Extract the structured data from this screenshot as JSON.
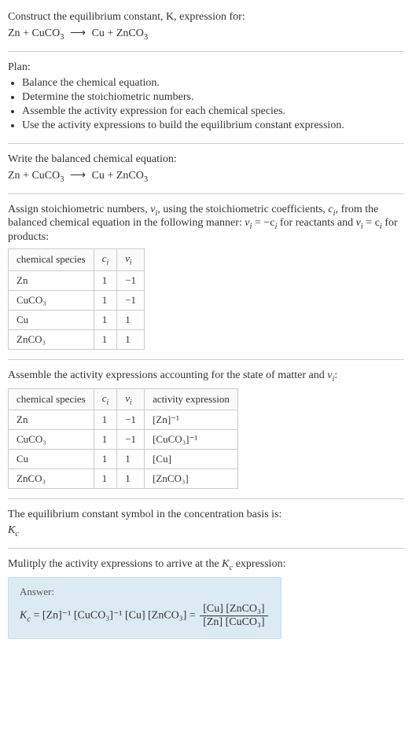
{
  "intro": {
    "line1": "Construct the equilibrium constant, K, expression for:",
    "equation_lhs_a": "Zn",
    "equation_lhs_b": "CuCO",
    "equation_lhs_b_sub": "3",
    "arrow": "⟶",
    "equation_rhs_a": "Cu",
    "equation_rhs_b": "ZnCO",
    "equation_rhs_b_sub": "3"
  },
  "plan": {
    "heading": "Plan:",
    "items": [
      "Balance the chemical equation.",
      "Determine the stoichiometric numbers.",
      "Assemble the activity expression for each chemical species.",
      "Use the activity expressions to build the equilibrium constant expression."
    ]
  },
  "balanced": {
    "heading": "Write the balanced chemical equation:"
  },
  "stoich": {
    "text_a": "Assign stoichiometric numbers, ",
    "nu": "ν",
    "sub_i": "i",
    "text_b": ", using the stoichiometric coefficients, ",
    "c": "c",
    "text_c": ", from the balanced chemical equation in the following manner: ",
    "eq1_lhs": "ν",
    "eq1_rhs": " = −c",
    "text_d": " for reactants and ",
    "eq2_rhs": " = c",
    "text_e": " for products:",
    "table": {
      "headers": [
        "chemical species",
        "cᵢ",
        "νᵢ"
      ],
      "rows": [
        [
          "Zn",
          "1",
          "−1"
        ],
        [
          "CuCO₃",
          "1",
          "−1"
        ],
        [
          "Cu",
          "1",
          "1"
        ],
        [
          "ZnCO₃",
          "1",
          "1"
        ]
      ]
    }
  },
  "activity": {
    "text_a": "Assemble the activity expressions accounting for the state of matter and ",
    "text_b": ":",
    "table": {
      "headers": [
        "chemical species",
        "cᵢ",
        "νᵢ",
        "activity expression"
      ],
      "rows": [
        [
          "Zn",
          "1",
          "−1",
          "[Zn]⁻¹"
        ],
        [
          "CuCO₃",
          "1",
          "−1",
          "[CuCO₃]⁻¹"
        ],
        [
          "Cu",
          "1",
          "1",
          "[Cu]"
        ],
        [
          "ZnCO₃",
          "1",
          "1",
          "[ZnCO₃]"
        ]
      ]
    }
  },
  "symbol": {
    "text": "The equilibrium constant symbol in the concentration basis is:",
    "kc": "K",
    "kc_sub": "c"
  },
  "multiply": {
    "text_a": "Mulitply the activity expressions to arrive at the ",
    "text_b": " expression:"
  },
  "answer": {
    "label": "Answer:",
    "kc": "K",
    "kc_sub": "c",
    "eq": " = [Zn]⁻¹ [CuCO₃]⁻¹ [Cu] [ZnCO₃] = ",
    "frac_num": "[Cu] [ZnCO₃]",
    "frac_den": "[Zn] [CuCO₃]"
  },
  "chart_data": {
    "type": "table",
    "tables": [
      {
        "title": "Stoichiometric numbers",
        "columns": [
          "chemical species",
          "c_i",
          "nu_i"
        ],
        "rows": [
          {
            "chemical species": "Zn",
            "c_i": 1,
            "nu_i": -1
          },
          {
            "chemical species": "CuCO3",
            "c_i": 1,
            "nu_i": -1
          },
          {
            "chemical species": "Cu",
            "c_i": 1,
            "nu_i": 1
          },
          {
            "chemical species": "ZnCO3",
            "c_i": 1,
            "nu_i": 1
          }
        ]
      },
      {
        "title": "Activity expressions",
        "columns": [
          "chemical species",
          "c_i",
          "nu_i",
          "activity expression"
        ],
        "rows": [
          {
            "chemical species": "Zn",
            "c_i": 1,
            "nu_i": -1,
            "activity expression": "[Zn]^-1"
          },
          {
            "chemical species": "CuCO3",
            "c_i": 1,
            "nu_i": -1,
            "activity expression": "[CuCO3]^-1"
          },
          {
            "chemical species": "Cu",
            "c_i": 1,
            "nu_i": 1,
            "activity expression": "[Cu]"
          },
          {
            "chemical species": "ZnCO3",
            "c_i": 1,
            "nu_i": 1,
            "activity expression": "[ZnCO3]"
          }
        ]
      }
    ]
  }
}
